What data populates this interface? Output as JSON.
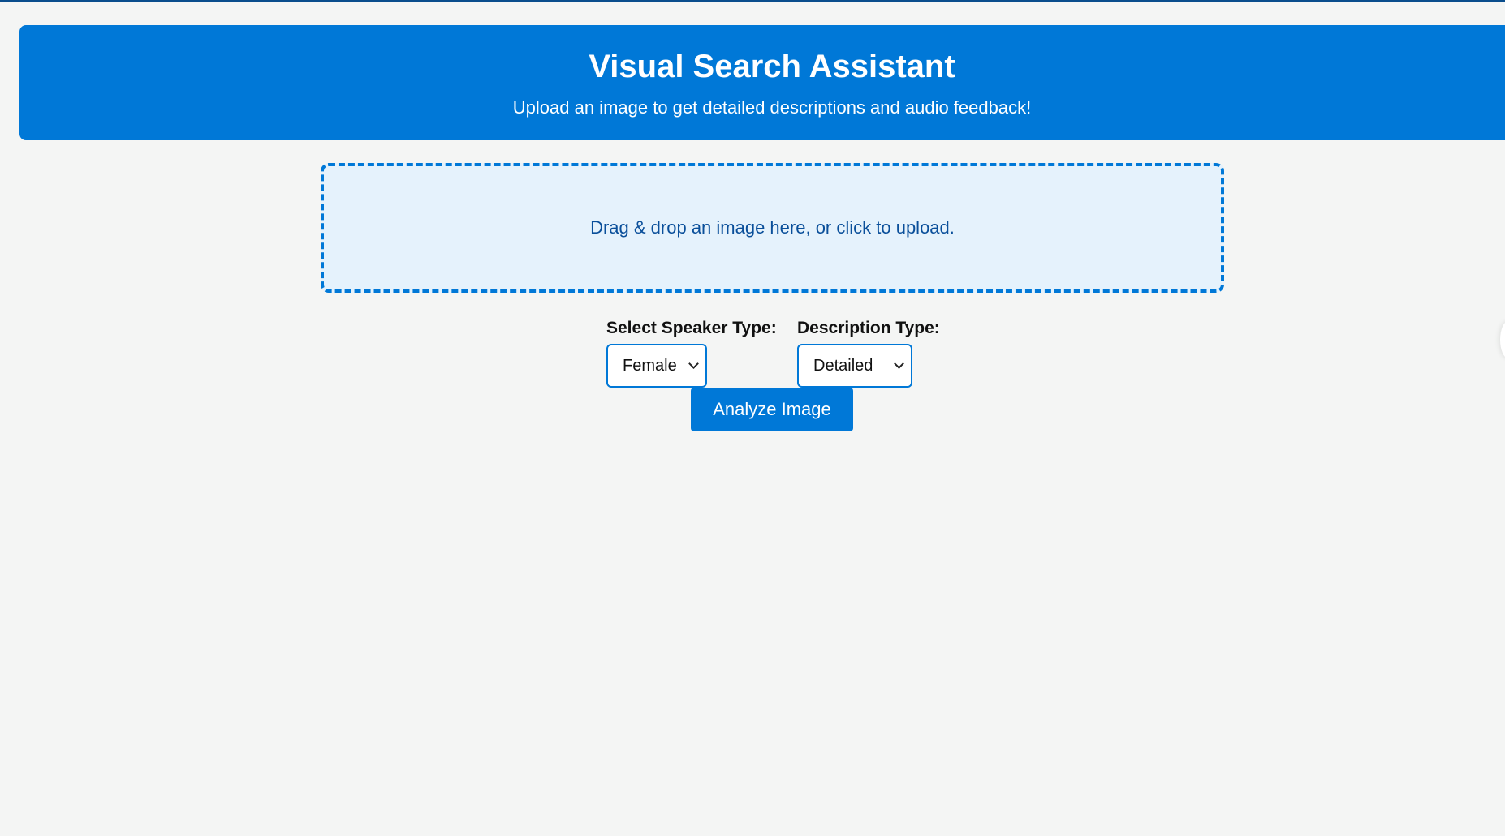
{
  "header": {
    "title": "Visual Search Assistant",
    "subtitle": "Upload an image to get detailed descriptions and audio feedback!"
  },
  "dropzone": {
    "text": "Drag & drop an image here, or click to upload."
  },
  "speaker": {
    "label": "Select Speaker Type:",
    "selected": "Female"
  },
  "description": {
    "label": "Description Type:",
    "selected": "Detailed"
  },
  "actions": {
    "analyze_label": "Analyze Image"
  },
  "colors": {
    "accent": "#0078d7",
    "dropzone_bg": "#e5f2fc",
    "page_bg": "#f4f5f4",
    "dropzone_text": "#0a4f9a"
  }
}
